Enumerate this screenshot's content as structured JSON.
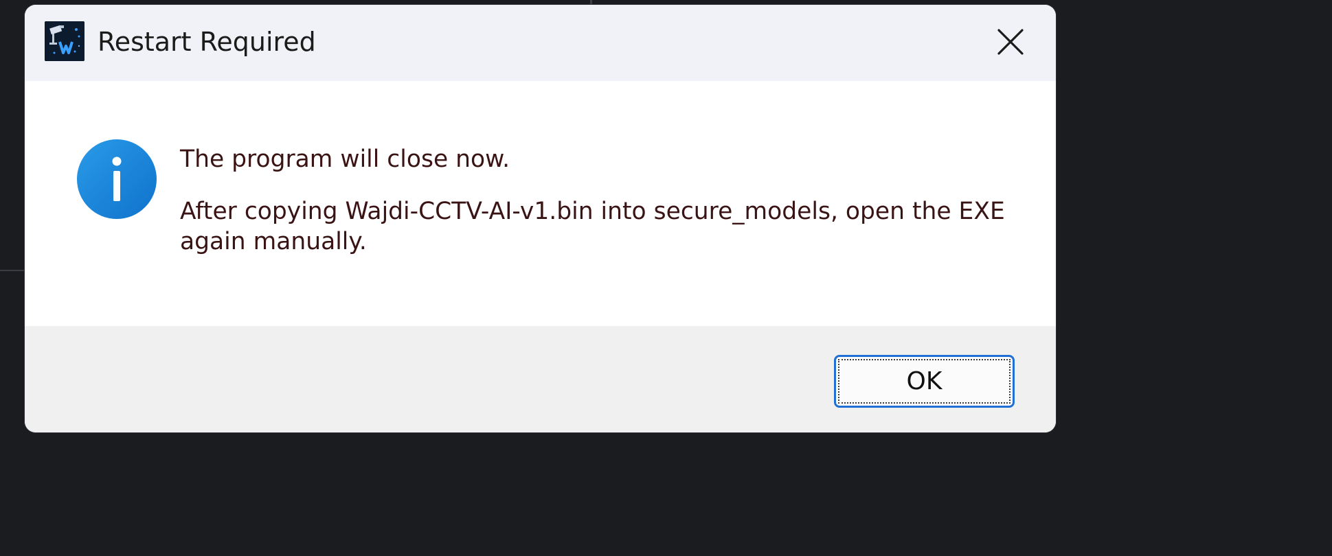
{
  "dialog": {
    "title": "Restart Required",
    "app_icon": "cctv-app-icon",
    "close_icon": "close-icon",
    "message_icon": "info-icon",
    "message_lines": [
      "The program will close now.",
      "After copying Wajdi-CCTV-AI-v1.bin into secure_models, open the EXE again manually."
    ],
    "ok_label": "OK"
  },
  "colors": {
    "title_bar": "#f1f2f7",
    "content": "#ffffff",
    "footer": "#f0f0f0",
    "accent": "#1f6fd4",
    "info_icon": "#1a86d9"
  }
}
